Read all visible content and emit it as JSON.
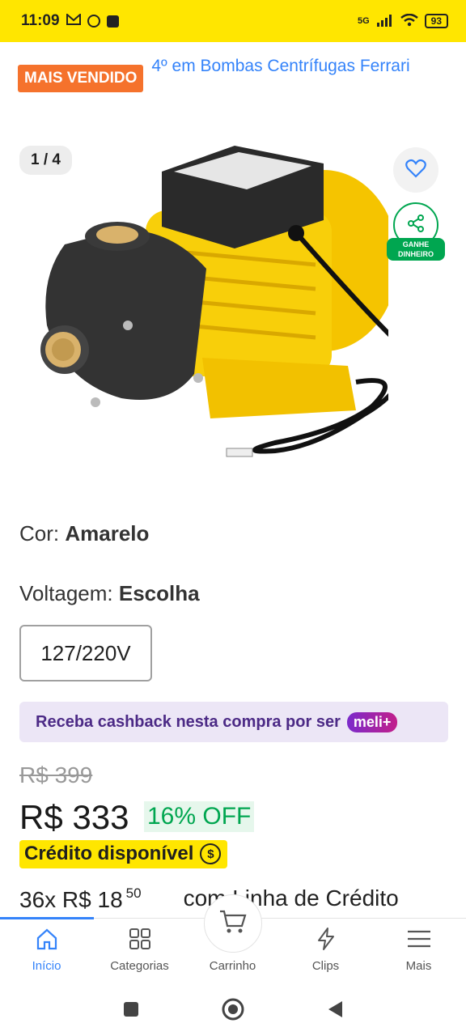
{
  "status_bar": {
    "time": "11:09",
    "network": "5G",
    "battery": "93"
  },
  "badge": {
    "label": "MAIS VENDIDO",
    "rank_text": "4º em Bombas Centrífugas Ferrari"
  },
  "gallery": {
    "counter": "1 / 4",
    "earn_label_1": "GANHE",
    "earn_label_2": "DINHEIRO"
  },
  "attributes": {
    "color_label": "Cor: ",
    "color_value": "Amarelo",
    "voltage_label": "Voltagem: ",
    "voltage_value": "Escolha",
    "voltage_option": "127/220V"
  },
  "cashback": {
    "text": "Receba cashback nesta compra por ser",
    "badge": "meli+"
  },
  "pricing": {
    "old_price": "R$ 399",
    "price": "R$ 333",
    "discount": "16% OFF",
    "credit_label": "Crédito disponível",
    "credit_icon": "$",
    "installments_prefix": "36x R$ 18",
    "installments_cents": "50",
    "installments_suffix": "com Linha de Crédito"
  },
  "bottom_nav": {
    "items": [
      {
        "label": "Início",
        "icon": "home-icon"
      },
      {
        "label": "Categorias",
        "icon": "grid-icon"
      },
      {
        "label": "Carrinho",
        "icon": "cart-icon"
      },
      {
        "label": "Clips",
        "icon": "lightning-icon"
      },
      {
        "label": "Mais",
        "icon": "menu-icon"
      }
    ]
  },
  "colors": {
    "accent": "#3483fa",
    "brand_yellow": "#ffe600",
    "green": "#00a650",
    "orange": "#f5722c"
  }
}
